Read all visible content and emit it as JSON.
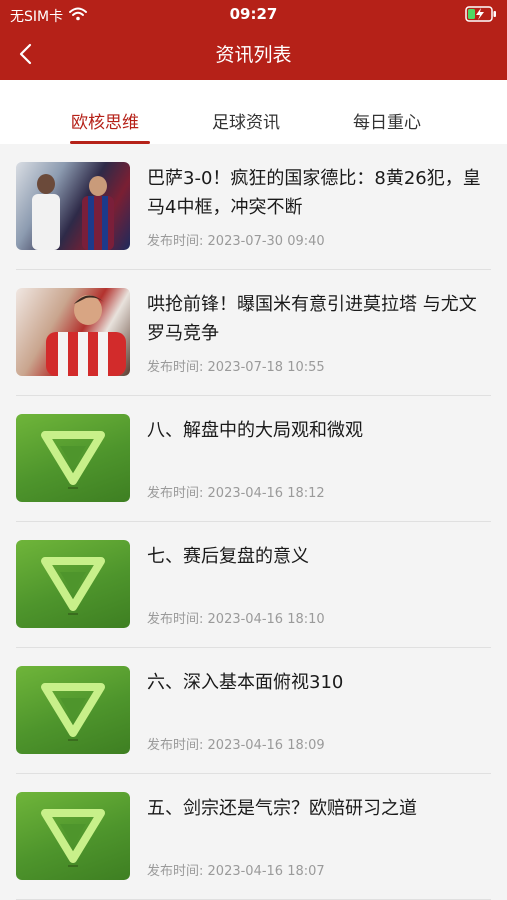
{
  "status_bar": {
    "carrier": "无SIM卡",
    "time": "09:27",
    "icons": [
      "wifi-icon",
      "battery-charging-icon"
    ]
  },
  "nav": {
    "title": "资讯列表",
    "back_icon": "chevron-left-icon"
  },
  "tabs": [
    {
      "label": "欧核思维",
      "active": true
    },
    {
      "label": "足球资讯",
      "active": false
    },
    {
      "label": "每日重心",
      "active": false
    }
  ],
  "list": {
    "time_prefix": "发布时间:",
    "items": [
      {
        "title": "巴萨3-0！疯狂的国家德比：8黄26犯，皇马4中框，冲突不断",
        "time": "2023-07-30 09:40",
        "thumb": "photo"
      },
      {
        "title": "哄抢前锋！曝国米有意引进莫拉塔 与尤文罗马竞争",
        "time": "2023-07-18 10:55",
        "thumb": "photo"
      },
      {
        "title": "八、解盘中的大局观和微观",
        "time": "2023-04-16 18:12",
        "thumb": "logo"
      },
      {
        "title": "七、赛后复盘的意义",
        "time": "2023-04-16 18:10",
        "thumb": "logo"
      },
      {
        "title": "六、深入基本面俯视310",
        "time": "2023-04-16 18:09",
        "thumb": "logo"
      },
      {
        "title": "五、剑宗还是气宗？欧赔研习之道",
        "time": "2023-04-16 18:07",
        "thumb": "logo"
      }
    ]
  },
  "colors": {
    "accent": "#b52118",
    "logo_green": "#4e952c",
    "logo_mark": "#c8f08a"
  }
}
